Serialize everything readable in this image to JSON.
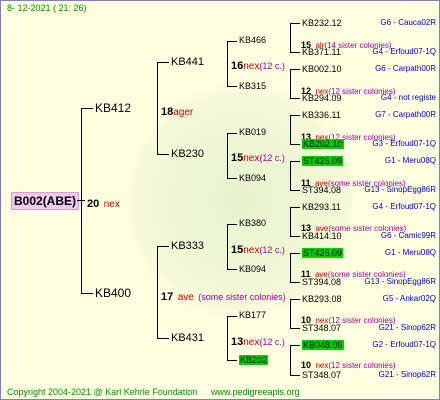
{
  "header": {
    "date": "8-  12-2021  (  21:  26)"
  },
  "footer": {
    "copyright": "Copyright 2004-2021 @ Karl Kehrle Foundation",
    "url": "www.pedigreeapis.org"
  },
  "root": {
    "id": "B002(ABE)",
    "num": "20",
    "label": "nex"
  },
  "gen1": [
    {
      "id": "KB412",
      "num": "18",
      "label": "ager",
      "sub": ""
    },
    {
      "id": "KB400",
      "num": "17",
      "label": "ave",
      "sub": "(some sister colonies)"
    }
  ],
  "gen2": [
    {
      "id": "KB441",
      "num": "16",
      "label": "nex",
      "sub": "(12 c.)"
    },
    {
      "id": "KB230",
      "num": "15",
      "label": "nex",
      "sub": "(12 c.)"
    },
    {
      "id": "KB333",
      "num": "15",
      "label": "nex",
      "sub": "(12 c.)"
    },
    {
      "id": "KB431",
      "num": "13",
      "label": "nex",
      "sub": "(12 c.)"
    }
  ],
  "gen3": [
    {
      "id": "KB466",
      "num": "15",
      "label": "alr",
      "sub": "(14 sister colonies)",
      "green": false
    },
    {
      "id": "KB315",
      "num": "12",
      "label": "nex",
      "sub": "(12 sister colonies)",
      "green": false
    },
    {
      "id": "KB019",
      "num": "13",
      "label": "nex",
      "sub": "(12 sister colonies)",
      "green": false
    },
    {
      "id": "KB094",
      "num": "11",
      "label": "ave",
      "sub": "(some sister colonies)",
      "green": false
    },
    {
      "id": "KB380",
      "num": "13",
      "label": "ave",
      "sub": "(some sister colonies)",
      "green": false
    },
    {
      "id": "KB094",
      "num": "11",
      "label": "ave",
      "sub": "(some sister colonies)",
      "green": false
    },
    {
      "id": "KB177",
      "num": "10",
      "label": "nex",
      "sub": "(12 sister colonies)",
      "green": false
    },
    {
      "id": "KB202",
      "num": "10",
      "label": "nex",
      "sub": "(12 sister colonies)",
      "green": true
    }
  ],
  "gen4": [
    {
      "id": "KB232.12",
      "green": false,
      "note": "G6 - Cauca02R"
    },
    {
      "id": "KB371.11",
      "green": false,
      "note": "G4 - Erfoud07-1Q"
    },
    {
      "id": "KB002.10",
      "green": false,
      "note": "G6 - Carpath00R"
    },
    {
      "id": "KB294.09",
      "green": false,
      "note": "G4 - not registe"
    },
    {
      "id": "KB336.11",
      "green": false,
      "note": "G7 - Carpath00R"
    },
    {
      "id": "KB202.10",
      "green": true,
      "note": "G3 - Erfoud07-1Q"
    },
    {
      "id": "ST426.09",
      "green": true,
      "note": "G1 - Meru08Q"
    },
    {
      "id": "ST394.08",
      "green": false,
      "note": "G13 - SinopEgg86R"
    },
    {
      "id": "KB293.11",
      "green": false,
      "note": "G4 - Erfoud07-1Q"
    },
    {
      "id": "KB414.10",
      "green": false,
      "note": "G6 - Camic99R"
    },
    {
      "id": "ST426.09",
      "green": true,
      "note": "G1 - Meru08Q"
    },
    {
      "id": "ST394.08",
      "green": false,
      "note": "G13 - SinopEgg86R"
    },
    {
      "id": "KB293.08",
      "green": false,
      "note": "G5 - Ankar02Q"
    },
    {
      "id": "ST348.07",
      "green": false,
      "note": "G21 - Sinop62R"
    },
    {
      "id": "KB048.09",
      "green": true,
      "note": "G2 - Erfoud07-1Q"
    },
    {
      "id": "ST348.07",
      "green": false,
      "note": "G21 - Sinop62R"
    }
  ]
}
